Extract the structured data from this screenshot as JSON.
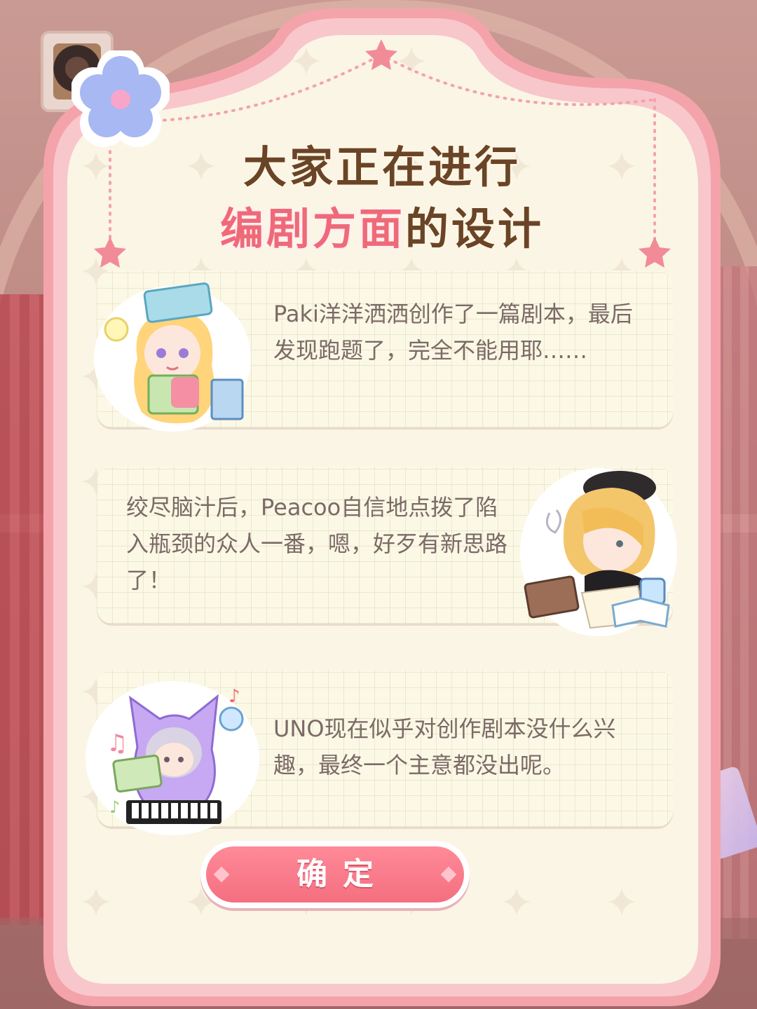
{
  "dialog": {
    "title_line1": "大家正在进行",
    "title_line2_highlight": "编剧方面",
    "title_line2_rest": "的设计",
    "cards": [
      {
        "text": "Paki洋洋洒洒创作了一篇剧本，最后发现跑题了，完全不能用耶……",
        "avatar": "paki-avatar-icon"
      },
      {
        "text": "绞尽脑汁后，Peacoo自信地点拨了陷入瓶颈的众人一番，嗯，好歹有新思路了！",
        "avatar": "peacoo-avatar-icon"
      },
      {
        "text": "UNO现在似乎对创作剧本没什么兴趣，最终一个主意都没出呢。",
        "avatar": "uno-avatar-icon"
      }
    ],
    "confirm_label": "确定"
  },
  "colors": {
    "frame": "#f4a3ab",
    "panel": "#fbf5e6",
    "title_brown": "#6a4427",
    "title_pink": "#ef6a78",
    "button": "#f46f80",
    "body_text": "#7b6a66"
  }
}
